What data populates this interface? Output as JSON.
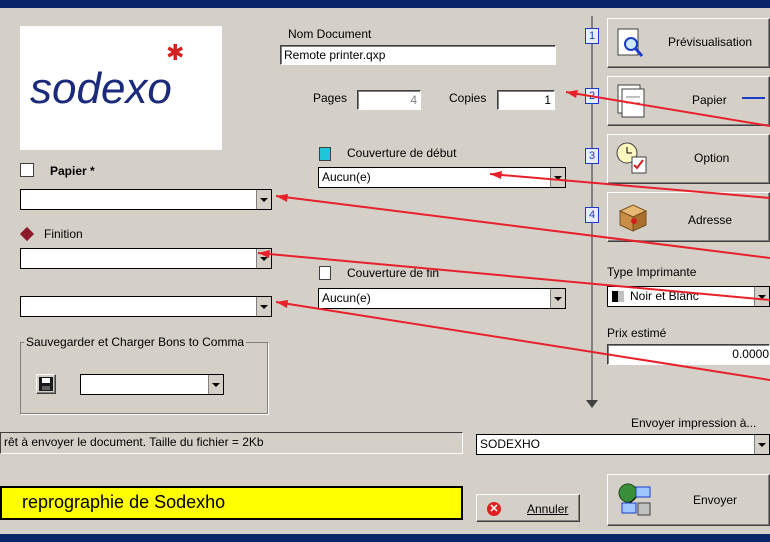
{
  "document": {
    "name_label": "Nom Document",
    "name_value": "Remote printer.qxp",
    "pages_label": "Pages",
    "pages_value": "4",
    "copies_label": "Copies",
    "copies_value": "1"
  },
  "logo": {
    "text": "sodexo"
  },
  "left": {
    "paper_label": "Papier *",
    "paper_value": "",
    "finish_label": "Finition",
    "finish_value": "",
    "third_value": "",
    "save_group_label": "Sauvegarder et Charger Bons to Comma",
    "save_combo_value": ""
  },
  "middle": {
    "cover_start_label": "Couverture de début",
    "cover_start_value": "Aucun(e)",
    "cover_end_label": "Couverture de fin",
    "cover_end_value": "Aucun(e)"
  },
  "steps": [
    {
      "num": "1",
      "label": "Prévisualisation"
    },
    {
      "num": "2",
      "label": "Papier"
    },
    {
      "num": "3",
      "label": "Option"
    },
    {
      "num": "4",
      "label": "Adresse"
    }
  ],
  "right": {
    "printer_type_label": "Type Imprimante",
    "printer_type_value": "Noir et Blanc",
    "price_label": "Prix estimé",
    "price_value": "0.0000",
    "send_to_label": "Envoyer impression à..."
  },
  "status": {
    "message": "rêt à envoyer le document. Taille du fichier = 2Kb",
    "destination": "SODEXHO",
    "banner": "reprographie de Sodexho"
  },
  "buttons": {
    "cancel": "Annuler",
    "send": "Envoyer"
  },
  "colors": {
    "accent": "#1a3cc8",
    "arrow": "#e8202a",
    "banner": "#ffff00"
  }
}
